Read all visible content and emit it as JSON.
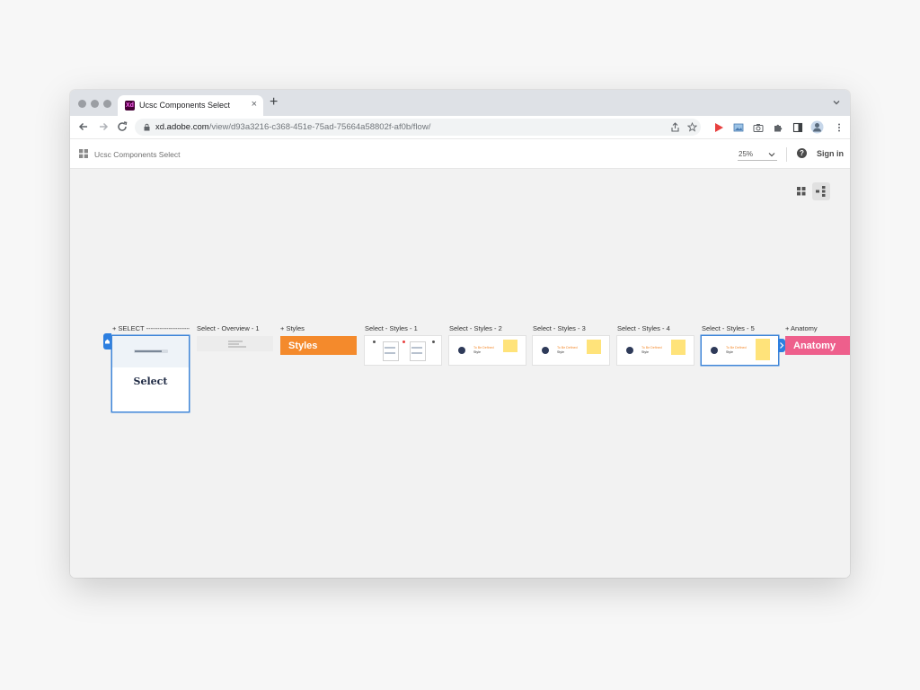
{
  "browser": {
    "tab_title": "Ucsc Components Select",
    "tab_favicon": "Xd",
    "url_host": "xd.adobe.com",
    "url_path": "/view/d93a3216-c368-451e-75ad-75664a58802f-af0b/flow/",
    "new_tab": "+",
    "close_tab": "×"
  },
  "appbar": {
    "title": "Ucsc Components Select",
    "zoom": "25%",
    "help": "?",
    "signin": "Sign in"
  },
  "flow": {
    "artboards": [
      {
        "label": "+ SELECT  -----------------------------------"
      },
      {
        "label": "Select - Overview - 1"
      },
      {
        "label": "+ Styles"
      },
      {
        "label": "Select - Styles - 1"
      },
      {
        "label": "Select - Styles - 2"
      },
      {
        "label": "Select - Styles - 3"
      },
      {
        "label": "Select - Styles - 4"
      },
      {
        "label": "Select - Styles - 5"
      },
      {
        "label": "+ Anatomy"
      }
    ],
    "select_heading": "Select",
    "styles_banner": "Styles",
    "anatomy_banner": "Anatomy",
    "mini_title": "To Be Defined",
    "mini_sub": "Style"
  },
  "colors": {
    "styles_banner": "#f48a2c",
    "anatomy_banner": "#ee5f8c",
    "selection_blue": "#3f86d9",
    "sticky_yellow": "#ffe37a"
  },
  "icons": {
    "back": "arrow-left-icon",
    "forward": "arrow-right-icon",
    "reload": "reload-icon",
    "lock": "lock-icon",
    "share": "share-icon",
    "bookmark": "star-icon",
    "grid": "grid-icon",
    "flow": "flow-view-icon"
  }
}
